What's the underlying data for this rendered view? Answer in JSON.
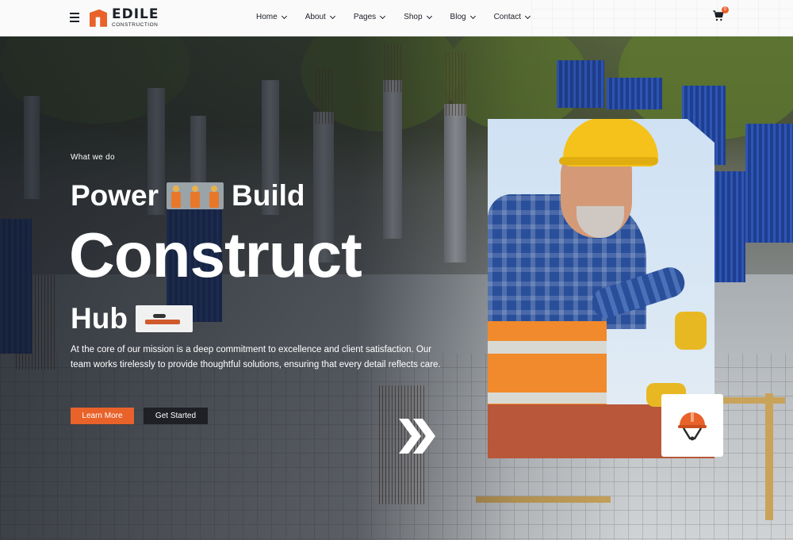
{
  "brand": {
    "name": "EDILE",
    "tagline": "CONSTRUCTION",
    "accent_color": "#e8622a"
  },
  "nav": {
    "items": [
      {
        "label": "Home",
        "icon": "chevron-down-icon"
      },
      {
        "label": "About",
        "icon": "chevron-down-icon"
      },
      {
        "label": "Pages",
        "icon": "chevron-down-icon"
      },
      {
        "label": "Shop",
        "icon": "chevron-down-icon"
      },
      {
        "label": "Blog",
        "icon": "chevron-down-icon"
      },
      {
        "label": "Contact",
        "icon": "chevron-down-icon"
      }
    ],
    "cart_count": "0"
  },
  "hero": {
    "eyebrow": "What we do",
    "heading_word_1": "Power",
    "heading_word_2": "Build",
    "heading_big": "Construct",
    "heading_word_3": "Hub",
    "description": "At the core of our mission is a deep commitment to excellence and client satisfaction. Our team works tirelessly to provide thoughtful solutions, ensuring that every detail reflects care.",
    "primary_button": "Learn More",
    "secondary_button": "Get Started"
  }
}
